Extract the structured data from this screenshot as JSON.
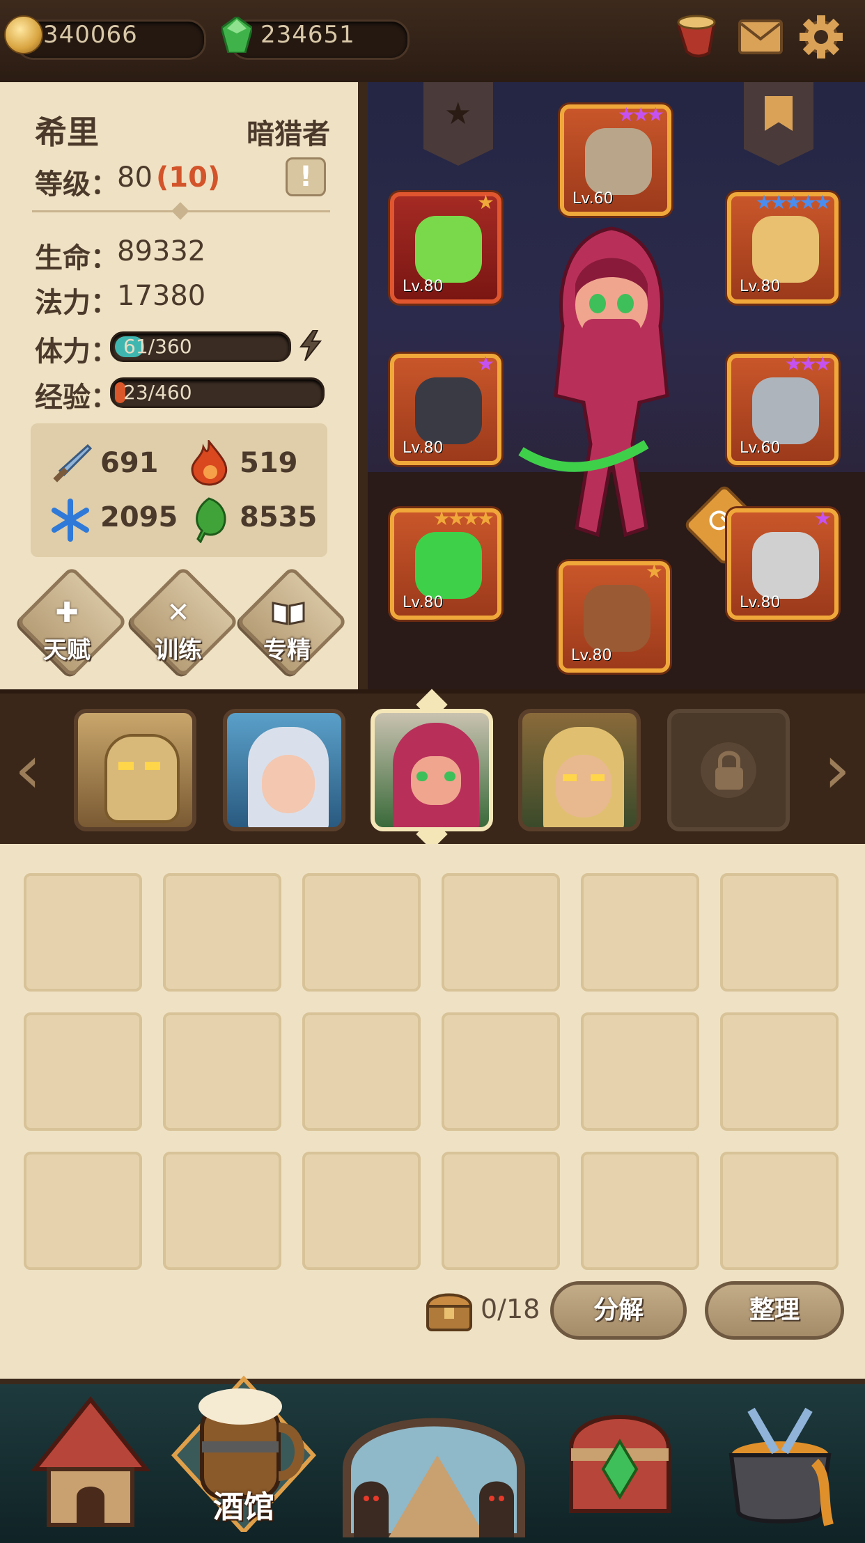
{
  "topbar": {
    "gold": "340066",
    "gems": "234651",
    "icons": [
      "horn-icon",
      "mail-icon",
      "gear-icon"
    ]
  },
  "hero": {
    "name": "希里",
    "class": "暗猎者",
    "level_label": "等级：",
    "level_value": "80",
    "level_bonus": "(10)",
    "hp_label": "生命：",
    "hp_value": "89332",
    "mp_label": "法力：",
    "mp_value": "17380",
    "stamina_label": "体力：",
    "stamina_text": "61/360",
    "stamina_fraction": 0.169,
    "exp_label": "经验：",
    "exp_text": "23/460",
    "exp_fraction": 0.05,
    "stats": {
      "attack": "691",
      "fire": "519",
      "ice": "2095",
      "nature": "8535"
    },
    "actions": [
      "天赋",
      "训练",
      "专精"
    ]
  },
  "equipment": [
    {
      "slot": "helmet",
      "level": "Lv.60",
      "stars": "★★★",
      "star_color": "#c552f0"
    },
    {
      "slot": "amulet",
      "level": "Lv.80",
      "stars": "★",
      "star_color": "#f0a83a"
    },
    {
      "slot": "ring",
      "level": "Lv.80",
      "stars": "★★★★★",
      "star_color": "#4a8df0"
    },
    {
      "slot": "gloves",
      "level": "Lv.80",
      "stars": "★",
      "star_color": "#c552f0"
    },
    {
      "slot": "armor",
      "level": "Lv.60",
      "stars": "★★★",
      "star_color": "#c552f0"
    },
    {
      "slot": "weapon",
      "level": "Lv.80",
      "stars": "★★★★",
      "star_color": "#f0a83a"
    },
    {
      "slot": "boots",
      "level": "Lv.80",
      "stars": "★",
      "star_color": "#f0a83a"
    },
    {
      "slot": "offhand",
      "level": "Lv.80",
      "stars": "★",
      "star_color": "#c552f0"
    }
  ],
  "bag": {
    "count": "0/18",
    "decompose": "分解",
    "sort": "整理"
  },
  "nav": {
    "tavern_label": "酒馆"
  }
}
